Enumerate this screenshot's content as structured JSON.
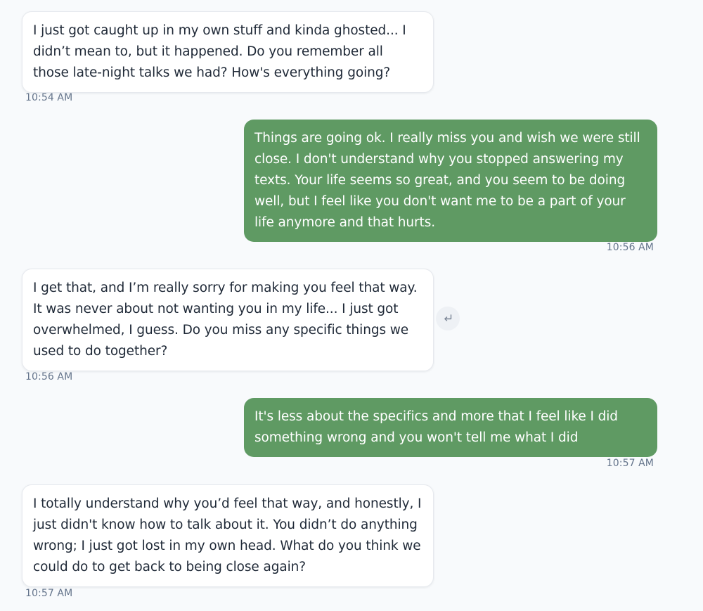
{
  "messages": [
    {
      "direction": "received",
      "text": "I just got caught up in my own stuff and kinda ghosted... I didn’t mean to, but it happened. Do you remember all those late-night talks we had? How's everything going?",
      "time": "10:54 AM"
    },
    {
      "direction": "sent",
      "text": "Things are going ok. I really miss you and wish we were still close. I don't understand why you stopped answering my texts. Your life seems so great, and you seem to be doing well, but I feel like you don't want me to be a part of your life anymore and that hurts.",
      "time": "10:56 AM"
    },
    {
      "direction": "received",
      "text": "I get that, and I’m really sorry for making you feel that way. It was never about not wanting you in my life... I just got overwhelmed, I guess. Do you miss any specific things we used to do together?",
      "time": "10:56 AM"
    },
    {
      "direction": "sent",
      "text": "It's less about the specifics and more that I feel like I did something wrong and you won't tell me what I did",
      "time": "10:57 AM"
    },
    {
      "direction": "received",
      "text": "I totally understand why you’d feel that way, and honestly, I just didn't know how to talk about it. You didn’t do anything wrong; I just got lost in my own head. What do you think we could do to get back to being close again?",
      "time": "10:57 AM"
    }
  ],
  "icons": {
    "reply": "reply-arrow-icon"
  },
  "colors": {
    "background": "#f8fafc",
    "received_bubble": "#ffffff",
    "sent_bubble": "#5f9a63",
    "timestamp": "#64748b"
  }
}
